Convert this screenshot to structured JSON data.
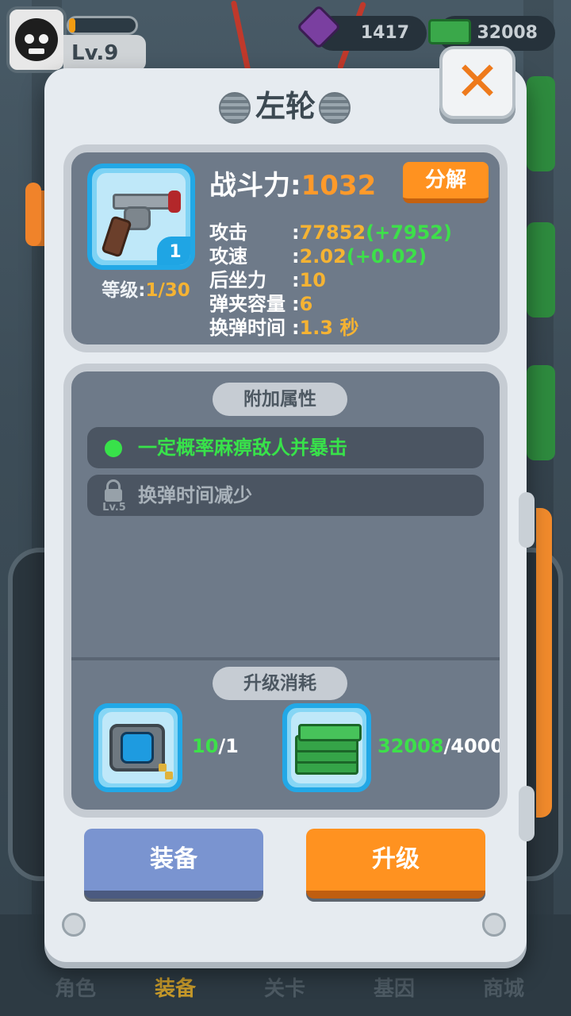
{
  "hud": {
    "level": "Lv.9",
    "xp_fraction": 0.1,
    "gems": "1417",
    "cash": "32008"
  },
  "bottom_nav": {
    "items": [
      {
        "label": "角色"
      },
      {
        "label": "装备"
      },
      {
        "label": "关卡"
      },
      {
        "label": "基因"
      },
      {
        "label": "商城"
      }
    ],
    "active_index": 1
  },
  "modal": {
    "title": "左轮",
    "weapon": {
      "icon": "revolver-icon",
      "slot_count": "1",
      "level_label": "等级:",
      "level_value": "1/30"
    },
    "power_label": "战斗力:",
    "power_value": "1032",
    "decompose_label": "分解",
    "stats": [
      {
        "label": "攻击",
        "sep": ":",
        "value": "77852",
        "bonus": "(+7952)"
      },
      {
        "label": "攻速",
        "sep": ":",
        "value": "2.02",
        "bonus": "(+0.02)"
      },
      {
        "label": "后坐力",
        "sep": ":",
        "value": "10",
        "bonus": ""
      },
      {
        "label": "弹夹容量",
        "sep": ":",
        "value": "6",
        "bonus": ""
      },
      {
        "label": "换弹时间",
        "sep": ":",
        "value": "1.3 秒",
        "bonus": ""
      }
    ],
    "extra_attr": {
      "title": "附加属性",
      "items": [
        {
          "text": "一定概率麻痹敌人并暴击",
          "locked": false
        },
        {
          "text": "换弹时间减少",
          "locked": true,
          "unlock_level": "Lv.5"
        }
      ]
    },
    "upgrade_cost": {
      "title": "升级消耗",
      "items": [
        {
          "icon": "chip-icon",
          "have": "10",
          "need": "/1"
        },
        {
          "icon": "cash-icon",
          "have": "32008",
          "need": "/4000"
        }
      ]
    },
    "equip_label": "装备",
    "upgrade_label": "升级",
    "close_symbol": "✕"
  },
  "colors": {
    "accent_orange": "#ff9220",
    "bonus_green": "#3de04a",
    "value_gold": "#f5b333",
    "slot_blue": "#22a8e6"
  }
}
